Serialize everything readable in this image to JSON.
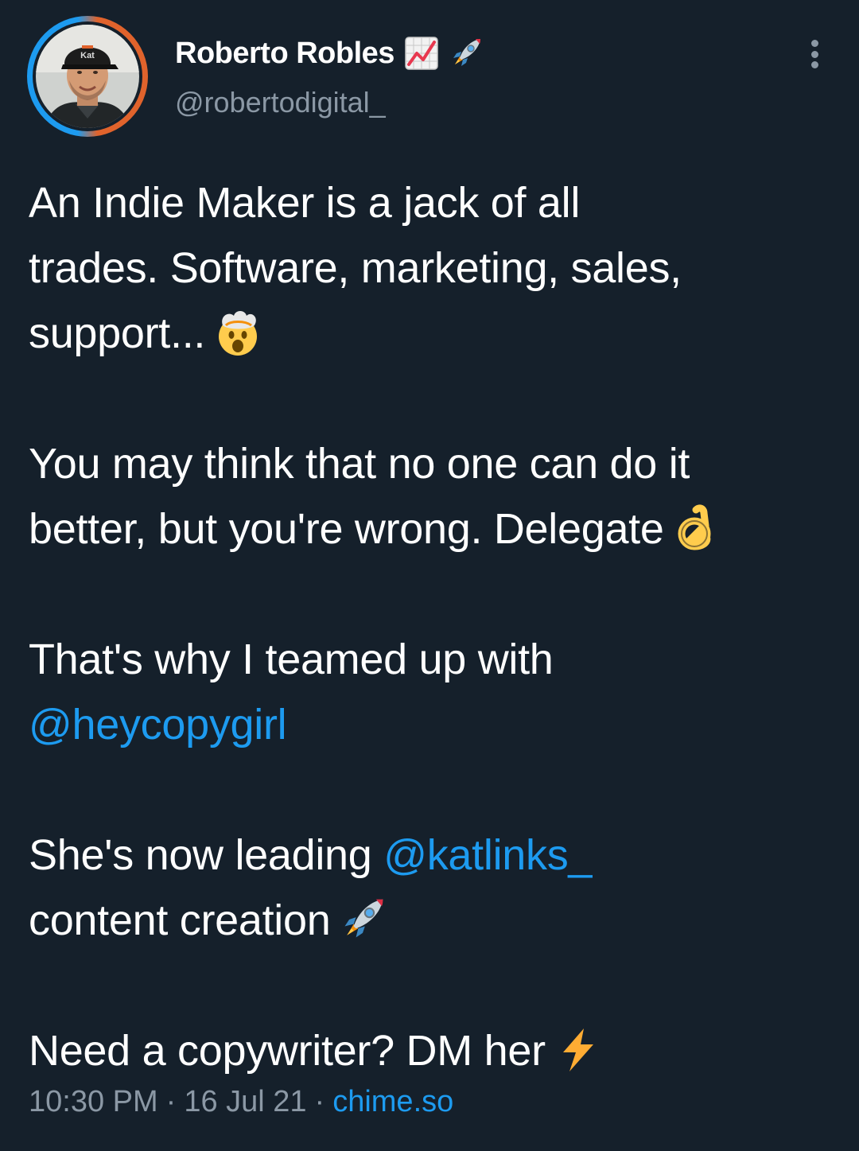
{
  "header": {
    "display_name": "Roberto Robles",
    "handle": "@robertodigital_",
    "name_emojis": [
      "chart-increasing-icon",
      "rocket-icon"
    ]
  },
  "body": {
    "p1_lines": [
      "An Indie Maker is a jack of all",
      "trades. Software, marketing, sales,",
      "support..."
    ],
    "p1_emoji": "exploding-head-icon",
    "p2_lines": [
      "You may think that no one can do it",
      "better, but you're wrong. Delegate"
    ],
    "p2_emoji": "ok-hand-icon",
    "p3_text": "That's why I teamed up with",
    "p3_mention": "@heycopygirl",
    "p4_text": "She's now leading",
    "p4_mention": "@katlinks_",
    "p4_rest": "content creation",
    "p4_emoji": "rocket-icon",
    "p5_text": "Need a copywriter? DM her",
    "p5_emoji": "high-voltage-icon"
  },
  "meta": {
    "time": "10:30 PM",
    "date": "16 Jul 21",
    "separator": "·",
    "source": "chime.so"
  },
  "colors": {
    "background": "#15202b",
    "text": "#ffffff",
    "secondary": "#8b98a5",
    "link": "#1d9bf0"
  }
}
